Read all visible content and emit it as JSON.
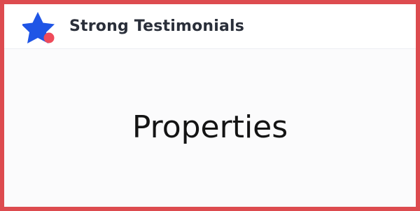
{
  "header": {
    "brand_name": "Strong Testimonials",
    "logo_icon": "star-with-dot-icon"
  },
  "main": {
    "title": "Properties"
  },
  "colors": {
    "frame_border": "#dd4b4f",
    "star": "#1f55e6",
    "dot": "#ef4b5a",
    "brand_text": "#2a2f3a",
    "title_text": "#141414"
  }
}
